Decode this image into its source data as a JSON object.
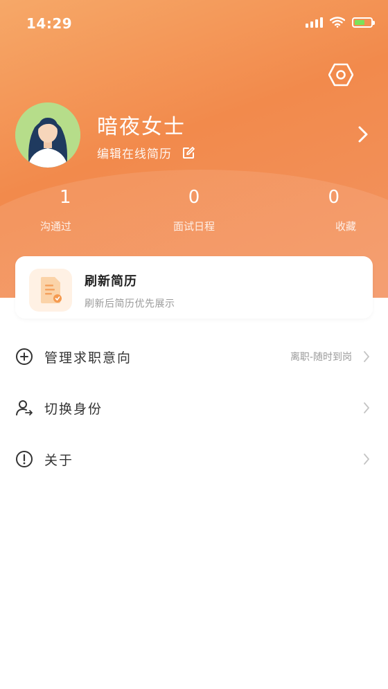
{
  "status_bar": {
    "time": "14:29",
    "icons": [
      "signal-icon",
      "wifi-icon",
      "battery-charging-icon"
    ]
  },
  "header": {
    "settings_icon": "settings-hexagon-icon",
    "avatar_icon": "woman-avatar",
    "username": "暗夜女士",
    "edit_resume_label": "编辑在线简历",
    "edit_icon": "edit-icon",
    "profile_chevron_icon": "chevron-right-icon",
    "gradient_colors": [
      "#f6a868",
      "#f28a4c",
      "#f39462"
    ]
  },
  "stats": [
    {
      "value": "1",
      "label": "沟通过"
    },
    {
      "value": "0",
      "label": "面试日程"
    },
    {
      "value": "0",
      "label": "收藏"
    }
  ],
  "refresh_card": {
    "icon": "resume-document-icon",
    "title": "刷新简历",
    "subtitle": "刷新后简历优先展示"
  },
  "menu": [
    {
      "icon": "plus-circle-icon",
      "label": "管理求职意向",
      "value": "离职-随时到岗"
    },
    {
      "icon": "switch-user-icon",
      "label": "切换身份",
      "value": ""
    },
    {
      "icon": "info-circle-icon",
      "label": "关于",
      "value": ""
    }
  ],
  "colors": {
    "accent": "#f28a4c",
    "text_primary": "#333333",
    "text_secondary": "#9a9a9a"
  }
}
